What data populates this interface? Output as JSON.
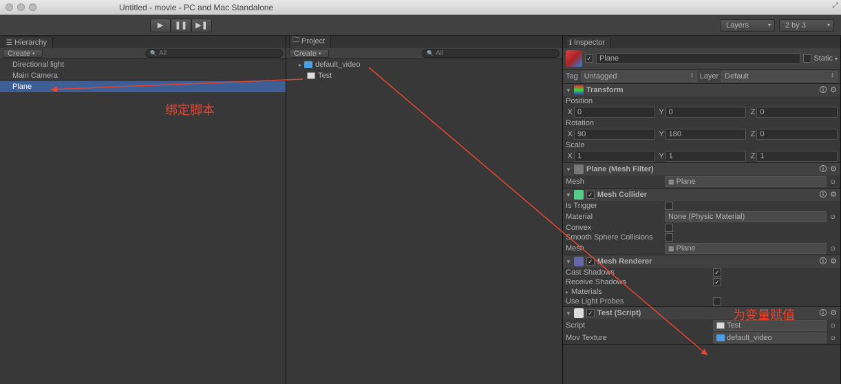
{
  "title": "Untitled - movie - PC and Mac Standalone",
  "toolbar": {
    "layers": "Layers",
    "layout": "2 by 3"
  },
  "hierarchy": {
    "tab": "Hierarchy",
    "create": "Create",
    "search": "All",
    "items": [
      "Directional light",
      "Main Camera",
      "Plane"
    ]
  },
  "project": {
    "tab": "Project",
    "create": "Create",
    "search": "All",
    "items": [
      {
        "name": "default_video",
        "type": "movie"
      },
      {
        "name": "Test",
        "type": "cs"
      }
    ]
  },
  "inspector": {
    "tab": "Inspector",
    "name": "Plane",
    "static": "Static",
    "tag_lbl": "Tag",
    "tag": "Untagged",
    "layer_lbl": "Layer",
    "layer": "Default",
    "transform": {
      "title": "Transform",
      "position": "Position",
      "rotation": "Rotation",
      "scale": "Scale",
      "pos": {
        "x": "0",
        "y": "0",
        "z": "0"
      },
      "rot": {
        "x": "90",
        "y": "180",
        "z": "0"
      },
      "scl": {
        "x": "1",
        "y": "1",
        "z": "1"
      },
      "X": "X",
      "Y": "Y",
      "Z": "Z"
    },
    "meshfilter": {
      "title": "Plane (Mesh Filter)",
      "mesh_lbl": "Mesh",
      "mesh": "Plane"
    },
    "collider": {
      "title": "Mesh Collider",
      "trigger": "Is Trigger",
      "material": "Material",
      "mat_val": "None (Physic Material)",
      "convex": "Convex",
      "smooth": "Smooth Sphere Collisions",
      "mesh_lbl": "Mesh",
      "mesh": "Plane"
    },
    "renderer": {
      "title": "Mesh Renderer",
      "cast": "Cast Shadows",
      "recv": "Receive Shadows",
      "mats": "Materials",
      "probes": "Use Light Probes"
    },
    "script": {
      "title": "Test (Script)",
      "script_lbl": "Script",
      "script": "Test",
      "tex_lbl": "Mov Texture",
      "tex": "default_video"
    }
  },
  "annot": {
    "bind": "绑定脚本",
    "assign": "为变量赋值"
  }
}
